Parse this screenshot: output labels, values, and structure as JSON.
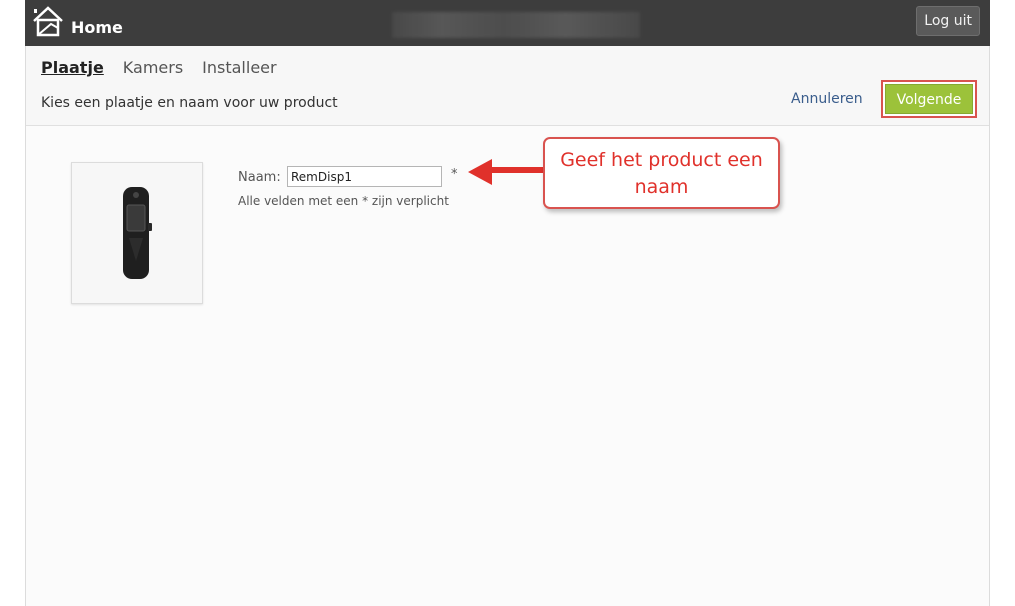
{
  "header": {
    "title": "Home",
    "logout_label": "Log uit"
  },
  "tabs": [
    {
      "label": "Plaatje",
      "active": true
    },
    {
      "label": "Kamers",
      "active": false
    },
    {
      "label": "Installeer",
      "active": false
    }
  ],
  "instruction": "Kies een plaatje en naam voor uw product",
  "actions": {
    "cancel_label": "Annuleren",
    "next_label": "Volgende"
  },
  "form": {
    "name_label": "Naam:",
    "name_value": "RemDisp1",
    "required_marker": "*",
    "required_note": "Alle velden met een * zijn verplicht"
  },
  "annotation": {
    "callout_text": "Geef het product een naam"
  },
  "colors": {
    "topbar": "#3d3d3d",
    "next_button": "#9cc23a",
    "highlight": "#d9534f",
    "link": "#3a5d8c"
  }
}
